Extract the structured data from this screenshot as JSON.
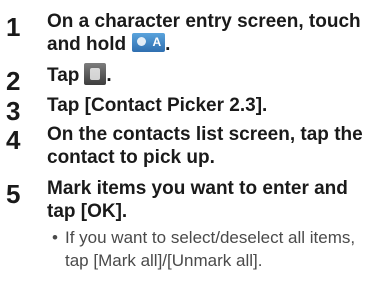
{
  "steps": [
    {
      "number": "1",
      "text": "On a character entry screen, touch and hold",
      "suffix": "."
    },
    {
      "number": "2",
      "text": "Tap",
      "suffix": "."
    },
    {
      "number": "3",
      "text": "Tap [Contact Picker 2.3]."
    },
    {
      "number": "4",
      "text": "On the contacts list screen, tap the contact to pick up."
    },
    {
      "number": "5",
      "text": "Mark items you want to enter and tap [OK]."
    }
  ],
  "note": {
    "bullet": "•",
    "text": "If you want to select/deselect all items, tap [Mark all]/[Unmark all]."
  }
}
